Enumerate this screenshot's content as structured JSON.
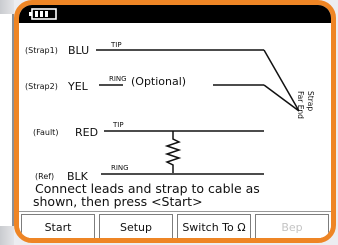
{
  "screen": {
    "wires": [
      {
        "prefix": "(Strap1)",
        "color_label": "BLU",
        "conductor": "TIP"
      },
      {
        "prefix": "(Strap2)",
        "color_label": "YEL",
        "conductor": "RING"
      },
      {
        "prefix": "(Fault)",
        "color_label": "RED",
        "conductor": "TIP"
      },
      {
        "prefix": "(Ref)",
        "color_label": "BLK",
        "conductor": "RING"
      }
    ],
    "optional_label": "(Optional)",
    "far_end_label": [
      "Far End",
      "Strap"
    ],
    "instruction_line1": "Connect leads and strap to cable as",
    "instruction_line2": "shown, then press <Start>"
  },
  "softkeys": [
    {
      "label": "Start",
      "enabled": true
    },
    {
      "label": "Setup",
      "enabled": true
    },
    {
      "label": "Switch To Ω",
      "enabled": true
    },
    {
      "label": "Bep",
      "enabled": false
    }
  ],
  "colors": {
    "frame": "#ee8525",
    "titlebar": "#000000",
    "disabled_text": "#c4c4c4"
  },
  "icons": {
    "battery": "battery-icon",
    "resistor": "resistor-symbol"
  }
}
